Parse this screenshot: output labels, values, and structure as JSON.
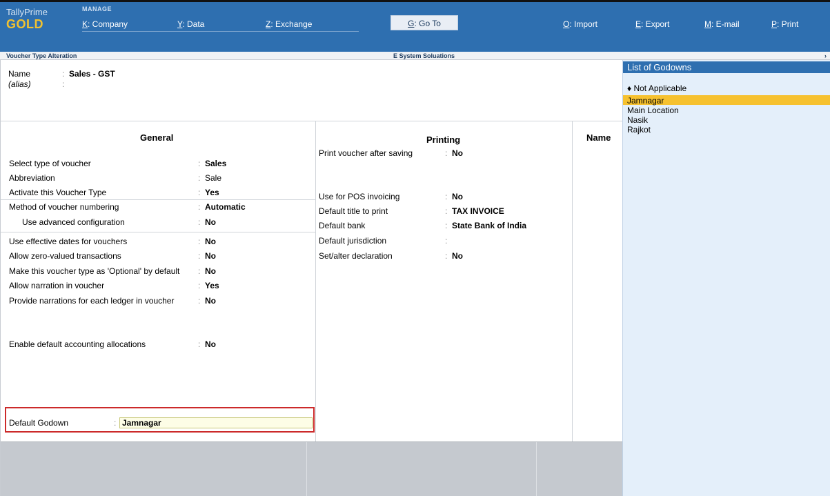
{
  "app": {
    "brand": "TallyPrime",
    "edition": "GOLD",
    "section": "MANAGE"
  },
  "menu": [
    {
      "key": "K",
      "label": ": Company"
    },
    {
      "key": "Y",
      "label": ": Data"
    },
    {
      "key": "Z",
      "label": ": Exchange"
    },
    {
      "key": "G",
      "label": ": Go To"
    },
    {
      "key": "O",
      "label": ": Import"
    },
    {
      "key": "E",
      "label": ": Export"
    },
    {
      "key": "M",
      "label": ": E-mail"
    },
    {
      "key": "P",
      "label": ": Print"
    }
  ],
  "subheader": {
    "screen": "Voucher Type Alteration",
    "company": "E System Soluations",
    "more": "›"
  },
  "header": {
    "name_label": "Name",
    "name_value": "Sales - GST",
    "alias_label": "(alias)",
    "alias_value": ""
  },
  "general": {
    "title": "General",
    "rows": [
      {
        "label": "Select type of voucher",
        "value": "Sales"
      },
      {
        "label": "Abbreviation",
        "value": "Sale"
      },
      {
        "label": "Activate this Voucher Type",
        "value": "Yes"
      },
      {
        "label": "Method of voucher numbering",
        "value": "Automatic"
      },
      {
        "label": "Use advanced configuration",
        "value": "No"
      },
      {
        "label": "Use effective dates for vouchers",
        "value": "No"
      },
      {
        "label": "Allow zero-valued transactions",
        "value": "No"
      },
      {
        "label": "Make this voucher type as 'Optional' by default",
        "value": "No"
      },
      {
        "label": "Allow narration in voucher",
        "value": "Yes"
      },
      {
        "label": "Provide narrations for each ledger in voucher",
        "value": "No"
      },
      {
        "label": "Enable default accounting allocations",
        "value": "No"
      }
    ],
    "godown_label": "Default Godown",
    "godown_value": "Jamnagar"
  },
  "printing": {
    "title": "Printing",
    "rows": [
      {
        "label": "Print voucher after saving",
        "value": "No"
      },
      {
        "label": "Use for POS invoicing",
        "value": "No"
      },
      {
        "label": "Default title to print",
        "value": "TAX INVOICE"
      },
      {
        "label": "Default bank",
        "value": "State Bank of India"
      },
      {
        "label": "Default jurisdiction",
        "value": ""
      },
      {
        "label": "Set/alter declaration",
        "value": "No"
      }
    ]
  },
  "third_panel": {
    "title": "Name"
  },
  "godowns": {
    "title": "List of Godowns",
    "items": [
      "Not Applicable",
      "Jamnagar",
      "Main Location",
      "Nasik",
      "Rajkot"
    ],
    "selected": "Jamnagar"
  },
  "colors": {
    "topbar": "#2e6fb0",
    "gold": "#f2c230",
    "highlight": "#f6c12f",
    "list_bg": "#e4effa",
    "outline": "#cc2a2a"
  }
}
